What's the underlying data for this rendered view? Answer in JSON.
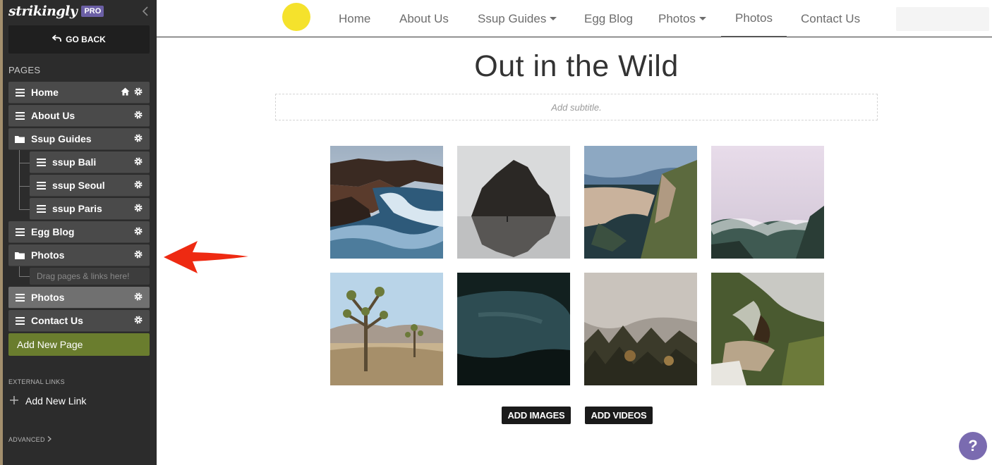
{
  "app": {
    "brand": "strikingly",
    "badge": "PRO"
  },
  "sidebar": {
    "go_back": "GO BACK",
    "pages_title": "PAGES",
    "pages": [
      {
        "label": "Home",
        "icon": "menu-icon",
        "home": true
      },
      {
        "label": "About Us",
        "icon": "menu-icon"
      },
      {
        "label": "Ssup Guides",
        "icon": "folder-icon"
      },
      {
        "label": "ssup Bali",
        "icon": "menu-icon",
        "child": true
      },
      {
        "label": "ssup Seoul",
        "icon": "menu-icon",
        "child": true
      },
      {
        "label": "ssup Paris",
        "icon": "menu-icon",
        "child": true
      },
      {
        "label": "Egg Blog",
        "icon": "menu-icon"
      },
      {
        "label": "Photos",
        "icon": "folder-icon"
      },
      {
        "label": "Photos",
        "icon": "menu-icon",
        "active": true
      },
      {
        "label": "Contact Us",
        "icon": "menu-icon"
      }
    ],
    "drag_hint": "Drag pages & links here!",
    "add_page": "Add New Page",
    "external_title": "EXTERNAL LINKS",
    "add_link": "Add New Link",
    "advanced": "ADVANCED"
  },
  "nav": {
    "items": [
      {
        "label": "Home"
      },
      {
        "label": "About Us"
      },
      {
        "label": "Ssup Guides",
        "dropdown": true
      },
      {
        "label": "Egg Blog"
      },
      {
        "label": "Photos",
        "dropdown": true
      },
      {
        "label": "Photos",
        "active": true
      },
      {
        "label": "Contact Us"
      }
    ],
    "logo_color": "#f5e22c"
  },
  "main": {
    "title": "Out in the Wild",
    "subtitle_placeholder": "Add subtitle.",
    "gallery": [
      {
        "name": "rocky-coast-waves"
      },
      {
        "name": "sea-rock-reflection"
      },
      {
        "name": "cliff-coastline"
      },
      {
        "name": "foggy-mountain"
      },
      {
        "name": "joshua-tree-desert"
      },
      {
        "name": "mountain-lake"
      },
      {
        "name": "misty-forest"
      },
      {
        "name": "volcanic-steam"
      }
    ],
    "add_images": "ADD IMAGES",
    "add_videos": "ADD VIDEOS"
  },
  "help": {
    "label": "?"
  },
  "colors": {
    "sidebar": "#2c2c2c",
    "add_page": "#6a7d2e",
    "arrow": "#ee2a12",
    "help": "#7a6bb0"
  }
}
